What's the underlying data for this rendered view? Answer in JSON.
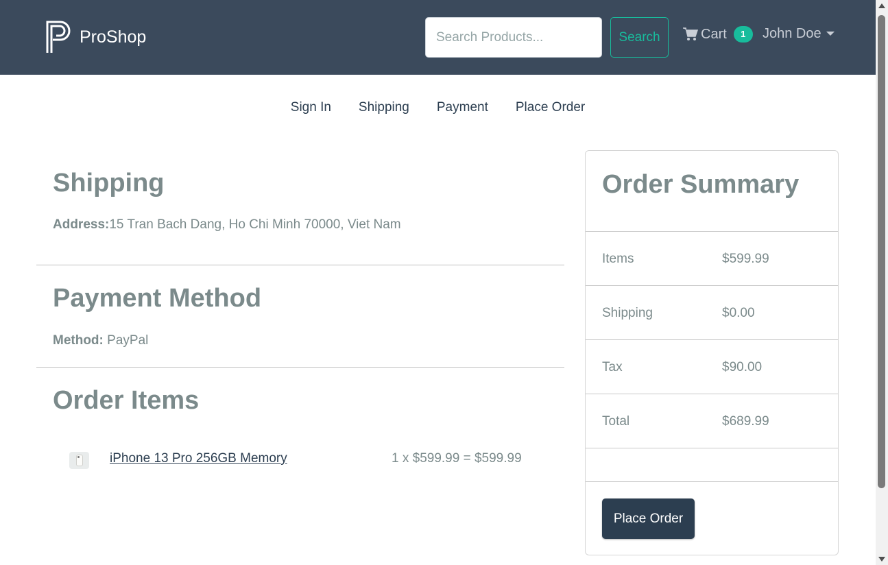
{
  "header": {
    "brand_name": "ProShop",
    "search_placeholder": "Search Products...",
    "search_label": "Search",
    "cart_label": "Cart",
    "cart_count": "1",
    "user_name": "John Doe",
    "colors": {
      "navbar": "#3b4a5c",
      "accent": "#18bc9c"
    }
  },
  "steps": [
    "Sign In",
    "Shipping",
    "Payment",
    "Place Order"
  ],
  "shipping": {
    "title": "Shipping",
    "address_label": "Address:",
    "address": "15 Tran Bach Dang, Ho Chi Minh 70000, Viet Nam"
  },
  "payment": {
    "title": "Payment Method",
    "method_label": "Method:",
    "method": " PayPal"
  },
  "order_items": {
    "title": "Order Items",
    "items": [
      {
        "name": "iPhone 13 Pro 256GB Memory",
        "calc": "1 x $599.99 = $599.99",
        "icon": "phone-image"
      }
    ]
  },
  "summary": {
    "title": "Order Summary",
    "rows": [
      {
        "label": "Items",
        "value": "$599.99"
      },
      {
        "label": "Shipping",
        "value": "$0.00"
      },
      {
        "label": "Tax",
        "value": "$90.00"
      },
      {
        "label": "Total",
        "value": "$689.99"
      }
    ],
    "place_order_label": "Place Order"
  }
}
